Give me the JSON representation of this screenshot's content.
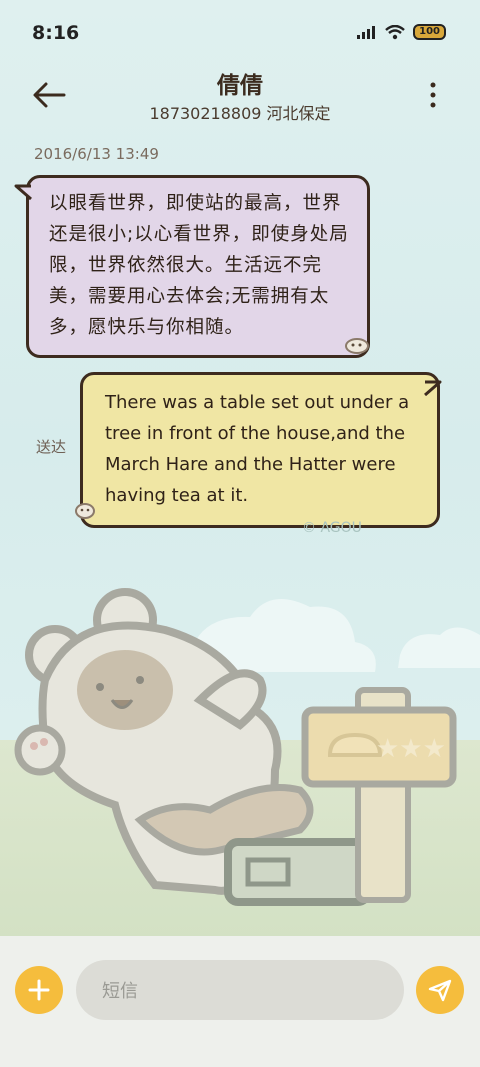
{
  "status_bar": {
    "time": "8:16",
    "battery": "100"
  },
  "header": {
    "contact_name": "倩倩",
    "contact_sub": "18730218809 河北保定"
  },
  "conversation": {
    "timestamp": "2016/6/13 13:49",
    "incoming_message": "以眼看世界，即使站的最高，世界还是很小;以心看世界，即使身处局限，世界依然很大。生活远不完美，需要用心去体会;无需拥有太多，愿快乐与你相随。",
    "outgoing_message": "There was a table set out under a tree in front of the house,and the March Hare and the Hatter were having tea at it.",
    "delivered_label": "送达",
    "watermark": "© AGOU"
  },
  "composer": {
    "placeholder": "短信"
  },
  "colors": {
    "incoming_bubble": "#e2d6e8",
    "outgoing_bubble": "#f0e6a4",
    "accent": "#f5bd3d",
    "bubble_border": "#3d2b1f"
  },
  "icons": {
    "back": "arrow-left-icon",
    "menu": "more-vertical-icon",
    "add": "plus-icon",
    "send": "paper-plane-icon"
  }
}
